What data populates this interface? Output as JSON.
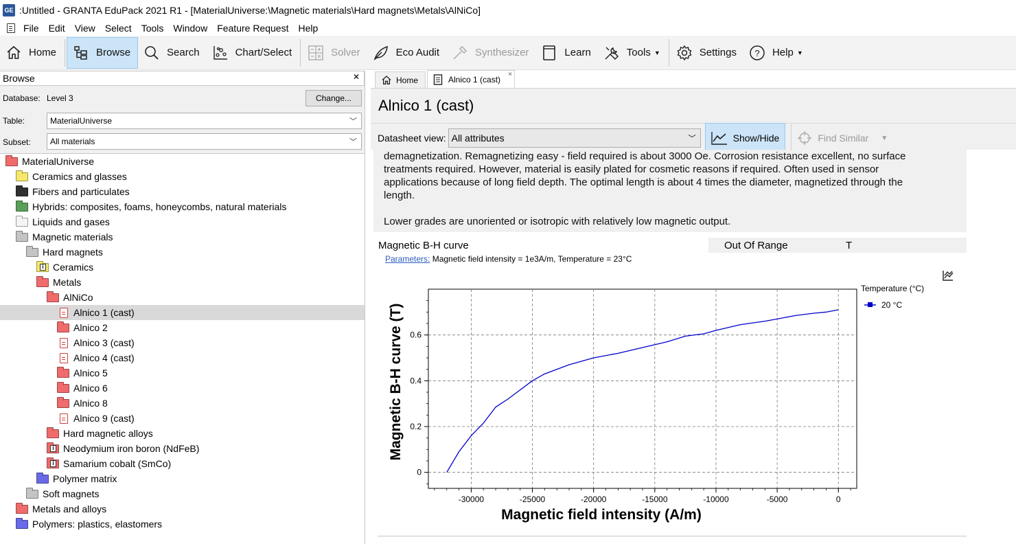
{
  "window": {
    "app_icon": "GE",
    "title": ":Untitled - GRANTA EduPack 2021 R1 - [MaterialUniverse:\\Magnetic materials\\Hard magnets\\Metals\\AlNiCo]"
  },
  "menu": [
    "File",
    "Edit",
    "View",
    "Select",
    "Tools",
    "Window",
    "Feature Request",
    "Help"
  ],
  "toolbar": {
    "home": "Home",
    "browse": "Browse",
    "search": "Search",
    "chart_select": "Chart/Select",
    "solver": "Solver",
    "eco_audit": "Eco Audit",
    "synthesizer": "Synthesizer",
    "learn": "Learn",
    "tools": "Tools",
    "settings": "Settings",
    "help": "Help"
  },
  "browse_panel": {
    "title": "Browse",
    "database_label": "Database:",
    "database_value": "Level 3",
    "change_button": "Change...",
    "table_label": "Table:",
    "table_value": "MaterialUniverse",
    "subset_label": "Subset:",
    "subset_value": "All materials",
    "tree": [
      {
        "label": "MaterialUniverse",
        "kind": "folder",
        "color": "red",
        "level": 0
      },
      {
        "label": "Ceramics and glasses",
        "kind": "folder",
        "color": "yellow",
        "level": 1
      },
      {
        "label": "Fibers and particulates",
        "kind": "folder",
        "color": "black",
        "level": 1
      },
      {
        "label": "Hybrids: composites, foams, honeycombs, natural materials",
        "kind": "folder",
        "color": "green",
        "level": 1
      },
      {
        "label": "Liquids and gases",
        "kind": "folder",
        "color": "white",
        "level": 1
      },
      {
        "label": "Magnetic materials",
        "kind": "folder",
        "color": "grey",
        "level": 1
      },
      {
        "label": "Hard magnets",
        "kind": "folder",
        "color": "grey",
        "level": 2
      },
      {
        "label": "Ceramics",
        "kind": "folder-info",
        "color": "yellow",
        "level": 3
      },
      {
        "label": "Metals",
        "kind": "folder",
        "color": "red",
        "level": 3
      },
      {
        "label": "AlNiCo",
        "kind": "folder",
        "color": "red",
        "level": 4
      },
      {
        "label": "Alnico 1 (cast)",
        "kind": "doc",
        "color": "red",
        "level": 5,
        "selected": true
      },
      {
        "label": "Alnico 2",
        "kind": "folder",
        "color": "red",
        "level": 5
      },
      {
        "label": "Alnico 3 (cast)",
        "kind": "doc",
        "color": "red",
        "level": 5
      },
      {
        "label": "Alnico 4 (cast)",
        "kind": "doc",
        "color": "red",
        "level": 5
      },
      {
        "label": "Alnico 5",
        "kind": "folder",
        "color": "red",
        "level": 5
      },
      {
        "label": "Alnico 6",
        "kind": "folder",
        "color": "red",
        "level": 5
      },
      {
        "label": "Alnico 8",
        "kind": "folder",
        "color": "red",
        "level": 5
      },
      {
        "label": "Alnico 9 (cast)",
        "kind": "doc",
        "color": "red",
        "level": 5
      },
      {
        "label": "Hard magnetic alloys",
        "kind": "folder",
        "color": "red",
        "level": 4
      },
      {
        "label": "Neodymium iron boron (NdFeB)",
        "kind": "folder-info",
        "color": "red",
        "level": 4
      },
      {
        "label": "Samarium cobalt (SmCo)",
        "kind": "folder-info",
        "color": "red",
        "level": 4
      },
      {
        "label": "Polymer matrix",
        "kind": "folder",
        "color": "blue",
        "level": 3
      },
      {
        "label": "Soft magnets",
        "kind": "folder",
        "color": "grey",
        "level": 2
      },
      {
        "label": "Metals and alloys",
        "kind": "folder",
        "color": "red",
        "level": 1
      },
      {
        "label": "Polymers: plastics, elastomers",
        "kind": "folder",
        "color": "blue",
        "level": 1
      }
    ]
  },
  "tabs": [
    {
      "label": "Home",
      "icon": "home-icon"
    },
    {
      "label": "Alnico 1 (cast)",
      "icon": "datasheet-icon",
      "closable": "×"
    }
  ],
  "datasheet": {
    "title": "Alnico 1 (cast)",
    "view_label": "Datasheet view:",
    "view_value": "All attributes",
    "show_hide": "Show/Hide",
    "find_similar": "Find Similar",
    "description_lines": [
      "demagnetization. Remagnetizing easy - field required is about 3000 Oe.  Corrosion resistance excellent, no surface",
      "treatments required. However, material is easily plated for cosmetic reasons if required.  Often used in sensor",
      "applications because of long field depth.  The optimal length is about 4 times the diameter, magnetized through the",
      "length."
    ],
    "description_extra": "Lower grades are unoriented or isotropic with relatively low magnetic output.",
    "bh_name": "Magnetic B-H curve",
    "bh_status": "Out Of Range",
    "bh_unit": "T",
    "params_link": "Parameters:",
    "params_text": "Magnetic field intensity = 1e3A/m, Temperature = 23°C"
  },
  "chart_data": {
    "type": "line",
    "xlabel": "Magnetic field intensity (A/m)",
    "ylabel": "Magnetic B-H curve (T)",
    "xlim": [
      -33500,
      1500
    ],
    "ylim": [
      -0.07,
      0.8
    ],
    "xticks": [
      -30000,
      -25000,
      -20000,
      -15000,
      -10000,
      -5000,
      0
    ],
    "yticks": [
      0,
      0.2,
      0.4,
      0.6
    ],
    "grid": true,
    "legend_title": "Temperature (°C)",
    "legend_position": "top-right",
    "series": [
      {
        "name": "20 °C",
        "color": "#0000cc",
        "x": [
          -32000,
          -31000,
          -30000,
          -29000,
          -28000,
          -27000,
          -26000,
          -25000,
          -24000,
          -22000,
          -20000,
          -18000,
          -16000,
          -14000,
          -12500,
          -11000,
          -10000,
          -8000,
          -6000,
          -5000,
          -3500,
          -2000,
          -1000,
          0
        ],
        "y": [
          0.0,
          0.09,
          0.16,
          0.215,
          0.285,
          0.32,
          0.36,
          0.4,
          0.43,
          0.47,
          0.5,
          0.52,
          0.545,
          0.57,
          0.595,
          0.605,
          0.62,
          0.645,
          0.66,
          0.67,
          0.685,
          0.695,
          0.7,
          0.71
        ]
      }
    ]
  }
}
